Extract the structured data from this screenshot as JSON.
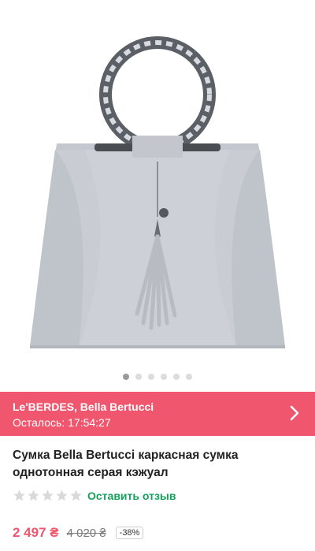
{
  "product": {
    "image_alt": "grey handbag",
    "gallery_count": 6,
    "gallery_active": 0,
    "title": "Сумка Bella Bertucci каркасная сумка однотонная серая кэжуал"
  },
  "promo": {
    "brand": "Le'BERDES, Bella Bertucci",
    "timer": "Осталось: 17:54:27",
    "bg_color": "#f0566e"
  },
  "rating": {
    "stars": 0,
    "max_stars": 5,
    "review_label": "Оставить отзыв",
    "link_color": "#17a05d"
  },
  "price": {
    "current": "2 497 ₴",
    "old": "4 020 ₴",
    "discount": "-38%"
  }
}
